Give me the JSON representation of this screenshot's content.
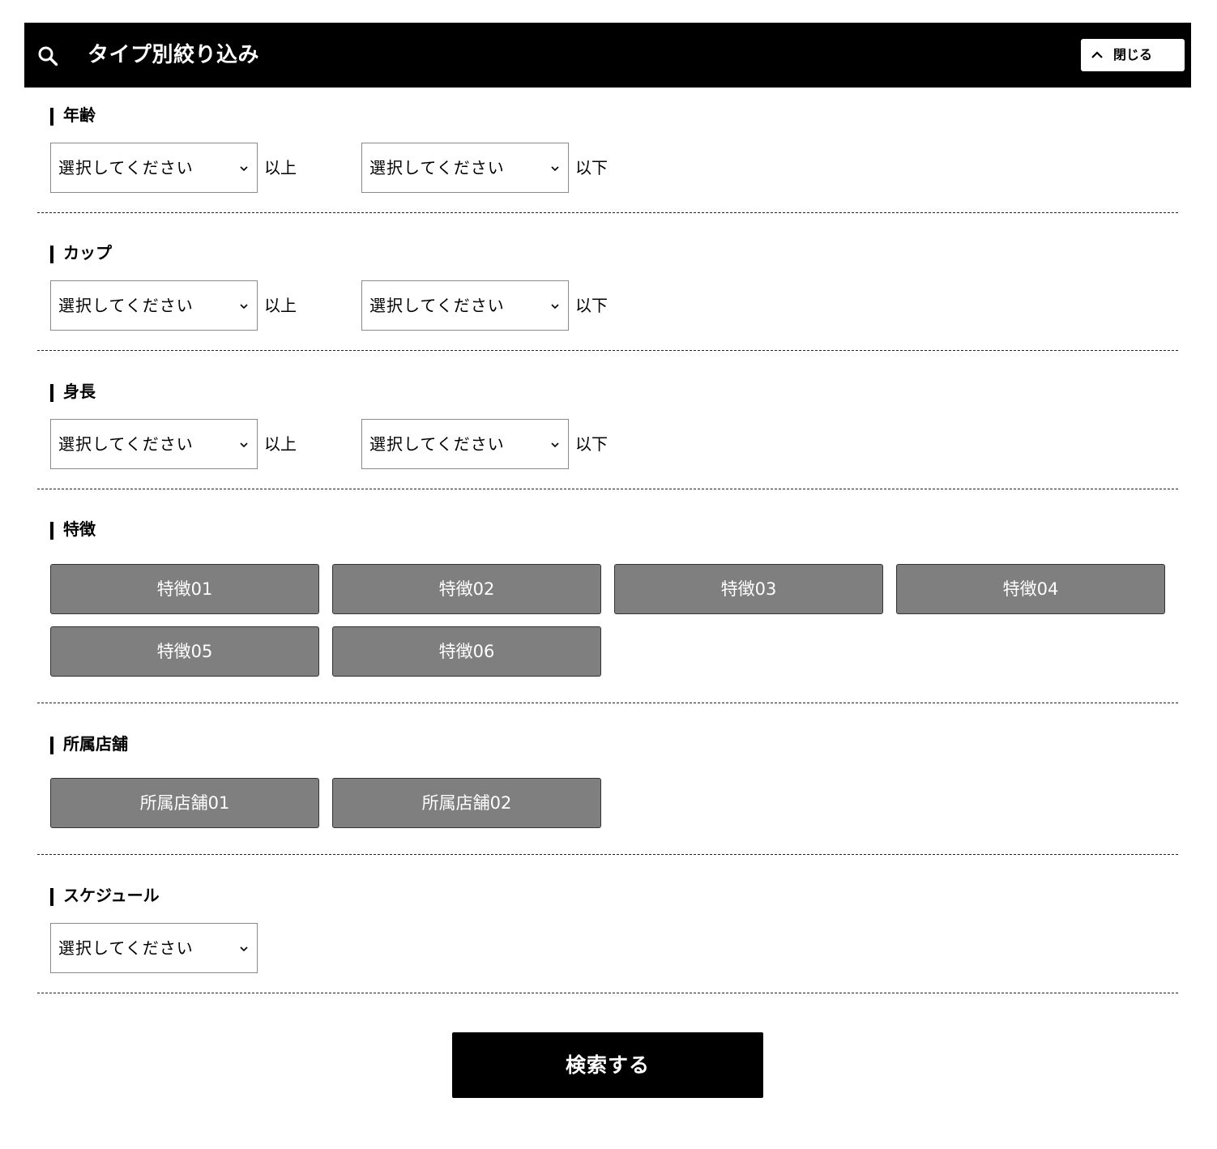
{
  "header": {
    "title": "タイプ別絞り込み",
    "icon": "search-icon",
    "close_label": "閉じる"
  },
  "sections": {
    "age": {
      "label": "年齢",
      "min_select": "選択してください",
      "min_suffix": "以上",
      "max_select": "選択してください",
      "max_suffix": "以下"
    },
    "cup": {
      "label": "カップ",
      "min_select": "選択してください",
      "min_suffix": "以上",
      "max_select": "選択してください",
      "max_suffix": "以下"
    },
    "height": {
      "label": "身長",
      "min_select": "選択してください",
      "min_suffix": "以上",
      "max_select": "選択してください",
      "max_suffix": "以下"
    },
    "features": {
      "label": "特徴",
      "items": [
        "特徴01",
        "特徴02",
        "特徴03",
        "特徴04",
        "特徴05",
        "特徴06"
      ]
    },
    "stores": {
      "label": "所属店舗",
      "items": [
        "所属店舗01",
        "所属店舗02"
      ]
    },
    "schedule": {
      "label": "スケジュール",
      "select": "選択してください"
    }
  },
  "submit_label": "検索する",
  "colors": {
    "header_bg": "#000000",
    "tag_bg": "#7f7f7f",
    "submit_bg": "#000000"
  }
}
